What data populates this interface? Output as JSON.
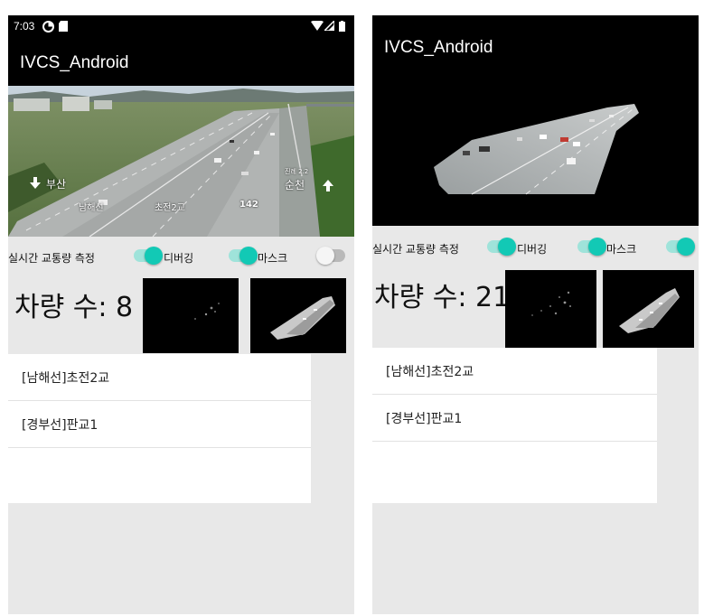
{
  "left": {
    "status": {
      "time": "7:03"
    },
    "app_title": "IVCS_Android",
    "overlay": {
      "location": "남해선",
      "bridge": "초전2교",
      "number": "142",
      "dir_left": "부산",
      "dir_right": "순천",
      "dist_right": "진례 2.2"
    },
    "controls": {
      "measure_label": "실시간 교통량 측정",
      "debug_label": "디버깅",
      "mask_label": "마스크"
    },
    "vehicle_count": "차량 수: 8",
    "list": [
      "[남해선]초전2교",
      "[경부선]판교1"
    ]
  },
  "right": {
    "app_title": "IVCS_Android",
    "controls": {
      "measure_label": "실시간 교통량 측정",
      "debug_label": "디버깅",
      "mask_label": "마스크"
    },
    "vehicle_count": "차량 수: 21",
    "list": [
      "[남해선]초전2교",
      "[경부선]판교1"
    ]
  },
  "colors": {
    "accent": "#12c9b5",
    "accent_track": "#9fe3da",
    "bar": "#000000",
    "panel": "#e8e8e8"
  },
  "icons": [
    "wifi-icon",
    "signal-icon",
    "battery-icon",
    "data-saver-icon",
    "sd-card-icon"
  ]
}
